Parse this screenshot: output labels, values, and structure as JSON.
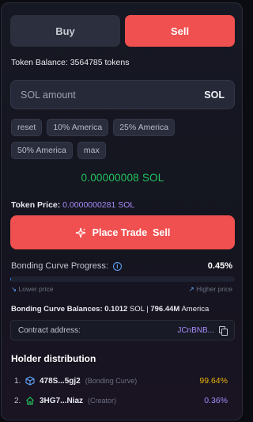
{
  "tabs": {
    "buy": "Buy",
    "sell": "Sell"
  },
  "balance": "Token Balance: 3564785 tokens",
  "amount": {
    "placeholder": "SOL amount",
    "unit": "SOL"
  },
  "presets": [
    "reset",
    "10% America",
    "25% America",
    "50% America",
    "max"
  ],
  "estimate": "0.00000008 SOL",
  "price": {
    "label": "Token Price:",
    "value": "0.0000000281 SOL"
  },
  "trade_button": "Place Trade  Sell",
  "bonding": {
    "label": "Bonding Curve Progress:",
    "percent_text": "0.45%",
    "progress": 0.0045,
    "lower": "Lower price",
    "higher": "Higher price"
  },
  "balances": {
    "label": "Bonding Curve Balances:",
    "sol": "0.1012",
    "sol_unit": "SOL |",
    "tokens": "796.44M",
    "token_name": "America"
  },
  "contract": {
    "label": "Contract address:",
    "address": "JCnBNB..."
  },
  "holders": {
    "title": "Holder distribution",
    "rows": [
      {
        "n": "1.",
        "icon": "cube-icon",
        "address": "478S...5gj2",
        "tag": "(Bonding Curve)",
        "percent": "99.64%",
        "color": "#eab308"
      },
      {
        "n": "2.",
        "icon": "home-icon",
        "address": "3HG7...Niaz",
        "tag": "(Creator)",
        "percent": "0.36%",
        "color": "#a78bfa"
      }
    ]
  },
  "colors": {
    "sell": "#f0504f",
    "estimate": "#22c55e",
    "price": "#a78bfa",
    "progress": "#3b82f6"
  }
}
